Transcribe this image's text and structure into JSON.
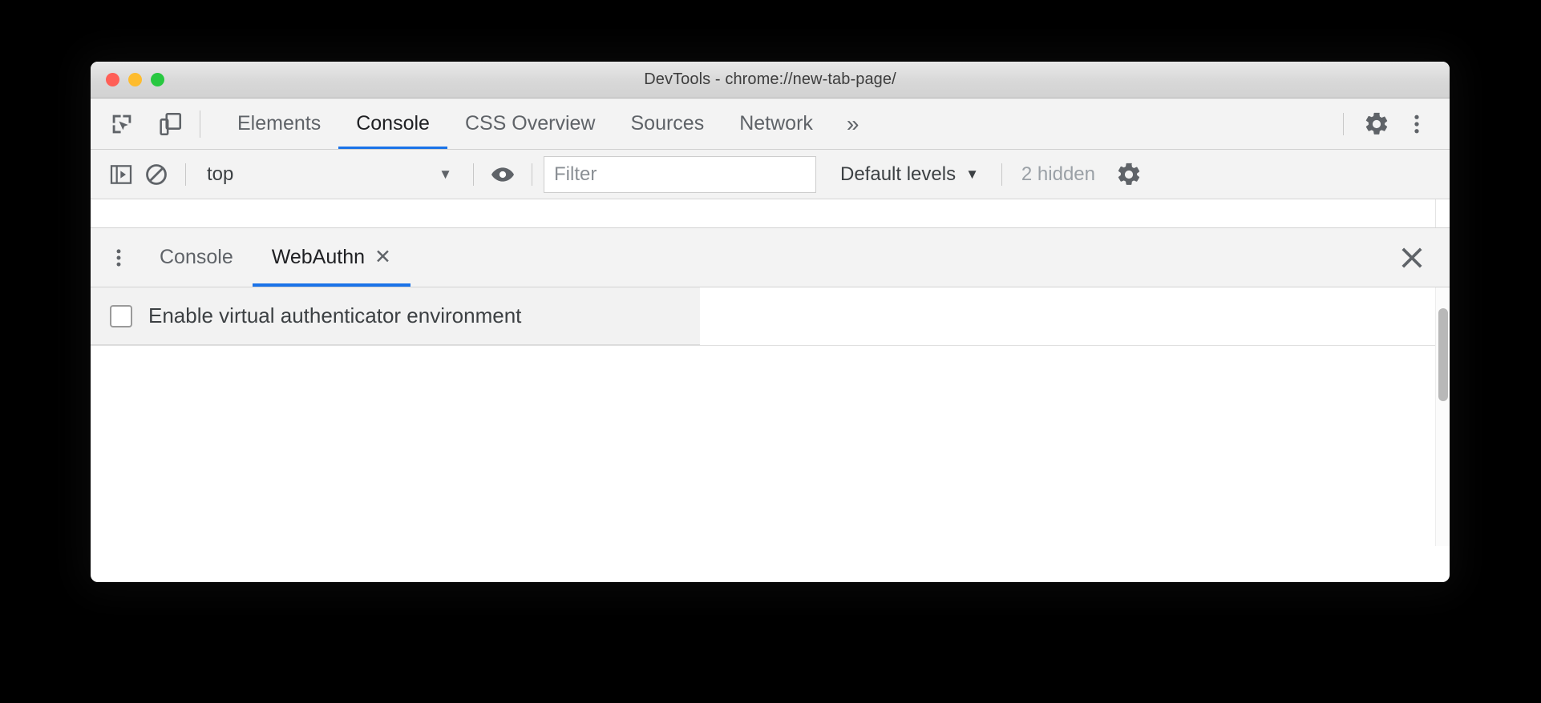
{
  "window": {
    "title": "DevTools - chrome://new-tab-page/",
    "traffic_lights": [
      {
        "name": "close",
        "color": "#ff5f57"
      },
      {
        "name": "minimize",
        "color": "#febc2e"
      },
      {
        "name": "zoom",
        "color": "#28c840"
      }
    ]
  },
  "main_toolbar": {
    "inspect_icon": "inspect-element-icon",
    "device_icon": "device-toolbar-icon",
    "settings_icon": "gear-icon",
    "more_icon": "kebab-menu-icon",
    "more_tabs_label": "»"
  },
  "main_tabs": [
    {
      "label": "Elements",
      "active": false
    },
    {
      "label": "Console",
      "active": true
    },
    {
      "label": "CSS Overview",
      "active": false
    },
    {
      "label": "Sources",
      "active": false
    },
    {
      "label": "Network",
      "active": false
    }
  ],
  "console_toolbar": {
    "sidebar_toggle_icon": "show-console-sidebar-icon",
    "clear_icon": "clear-console-icon",
    "context": "top",
    "context_caret": "▼",
    "eye_icon": "live-expression-eye-icon",
    "filter_placeholder": "Filter",
    "filter_value": "",
    "levels_label": "Default levels",
    "levels_caret": "▼",
    "hidden_label": "2 hidden",
    "settings_icon": "gear-icon"
  },
  "drawer": {
    "menu_icon": "kebab-menu-icon",
    "close_icon": "close-icon",
    "close_glyph": "✕",
    "tabs": [
      {
        "label": "Console",
        "active": false,
        "closable": false
      },
      {
        "label": "WebAuthn",
        "active": true,
        "closable": true,
        "close_glyph": "✕"
      }
    ]
  },
  "webauthn_panel": {
    "enable_checkbox_label": "Enable virtual authenticator environment",
    "enable_checkbox_checked": false
  },
  "colors": {
    "accent": "#1a73e8",
    "titlebar": "#d8d8d8",
    "toolbar_bg": "#f3f3f3",
    "text_primary": "#202124",
    "text_secondary": "#5f6368",
    "text_muted": "#9aa0a6",
    "row_bg": "#f2f2f2"
  }
}
